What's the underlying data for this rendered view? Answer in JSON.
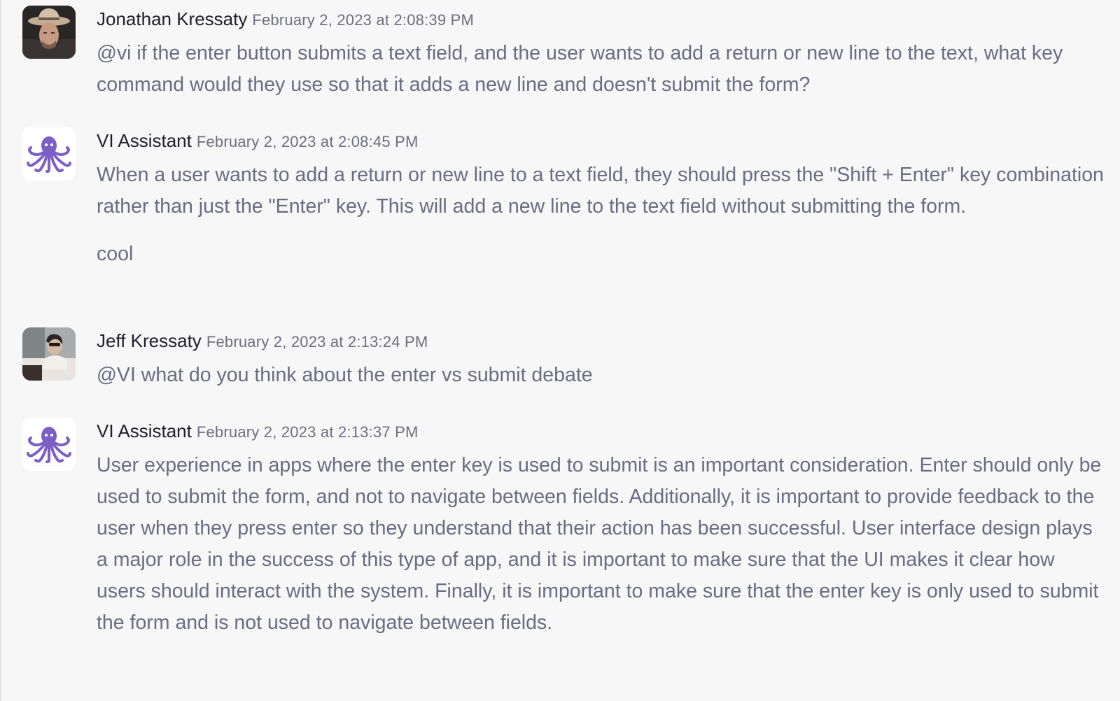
{
  "messages": [
    {
      "author": "Jonathan Kressaty",
      "time": "February 2, 2023 at 2:08:39 PM",
      "paragraphs": [
        "@vi if the enter button submits a text field, and the user wants to add a return or new line to the text, what key command would they use so that it adds a new line and doesn't submit the form?"
      ]
    },
    {
      "author": "VI Assistant",
      "time": "February 2, 2023 at 2:08:45 PM",
      "paragraphs": [
        "When a user wants to add a return or new line to a text field, they should press the \"Shift + Enter\" key combination rather than just the \"Enter\" key. This will add a new line to the text field without submitting the form.",
        "cool"
      ]
    },
    {
      "author": "Jeff Kressaty",
      "time": "February 2, 2023 at 2:13:24 PM",
      "paragraphs": [
        "@VI what do you think about the enter vs submit debate"
      ]
    },
    {
      "author": "VI Assistant",
      "time": "February 2, 2023 at 2:13:37 PM",
      "paragraphs": [
        "User experience in apps where the enter key is used to submit is an important consideration. Enter should only be used to submit the form, and not to navigate between fields. Additionally, it is important to provide feedback to the user when they press enter so they understand that their action has been successful. User interface design plays a major role in the success of this type of app, and it is important to make sure that the UI makes it clear how users should interact with the system. Finally, it is important to make sure that the enter key is only used to submit the form and is not used to navigate between fields."
      ]
    }
  ],
  "icons": {
    "bot_avatar": "octopus-icon",
    "bot_color": "#7b5fc6"
  }
}
